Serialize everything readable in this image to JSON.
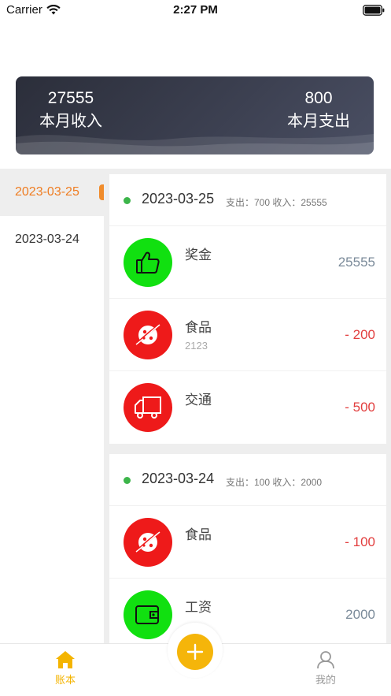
{
  "status_bar": {
    "carrier": "Carrier",
    "time": "2:27 PM"
  },
  "summary": {
    "income_value": "27555",
    "income_label": "本月收入",
    "expense_value": "800",
    "expense_label": "本月支出"
  },
  "sidebar": {
    "items": [
      {
        "label": "2023-03-25",
        "active": true
      },
      {
        "label": "2023-03-24",
        "active": false
      }
    ]
  },
  "days": [
    {
      "date": "2023-03-25",
      "meta": "支出：700 收入：25555",
      "records": [
        {
          "name": "奖金",
          "note": "",
          "amount": "25555",
          "type": "income",
          "icon": "thumbs-up-icon",
          "color": "#11e010"
        },
        {
          "name": "食品",
          "note": "2123",
          "amount": "- 200",
          "type": "expense",
          "icon": "food-icon",
          "color": "#ee1a1a"
        },
        {
          "name": "交通",
          "note": "",
          "amount": "- 500",
          "type": "expense",
          "icon": "truck-icon",
          "color": "#ee1a1a"
        }
      ]
    },
    {
      "date": "2023-03-24",
      "meta": "支出：100 收入：2000",
      "records": [
        {
          "name": "食品",
          "note": "",
          "amount": "- 100",
          "type": "expense",
          "icon": "food-icon",
          "color": "#ee1a1a"
        },
        {
          "name": "工资",
          "note": "",
          "amount": "2000",
          "type": "income",
          "icon": "wallet-icon",
          "color": "#11e010"
        }
      ]
    }
  ],
  "tabbar": {
    "home_label": "账本",
    "add_icon": "plus-icon",
    "mine_label": "我的",
    "active_color": "#f4b400"
  }
}
